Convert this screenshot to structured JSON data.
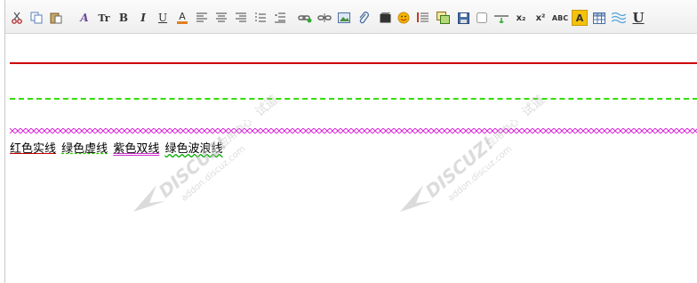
{
  "toolbar": {
    "bold_label": "B",
    "italic_label": "I",
    "underline_label": "U",
    "font_size_label": "Tr",
    "font_label": "A",
    "font_color_label": "A",
    "subscript_label": "x₂",
    "superscript_label": "x²",
    "spell_label": "ABC",
    "backcolor_label": "A",
    "underline_style_label": "U"
  },
  "content": {
    "samples": [
      {
        "text": "红色实线"
      },
      {
        "text": "绿色虚线"
      },
      {
        "text": "紫色双线"
      },
      {
        "text": "绿色波浪线"
      }
    ]
  },
  "watermark": {
    "brand": "DISCUZ!",
    "cn": "应用中心",
    "domain": "addon.discuz.com",
    "sign": "试道"
  },
  "colors": {
    "red_line": "#cc0000",
    "green_dash": "#33dd00",
    "purple_wave": "#dd33dd"
  }
}
